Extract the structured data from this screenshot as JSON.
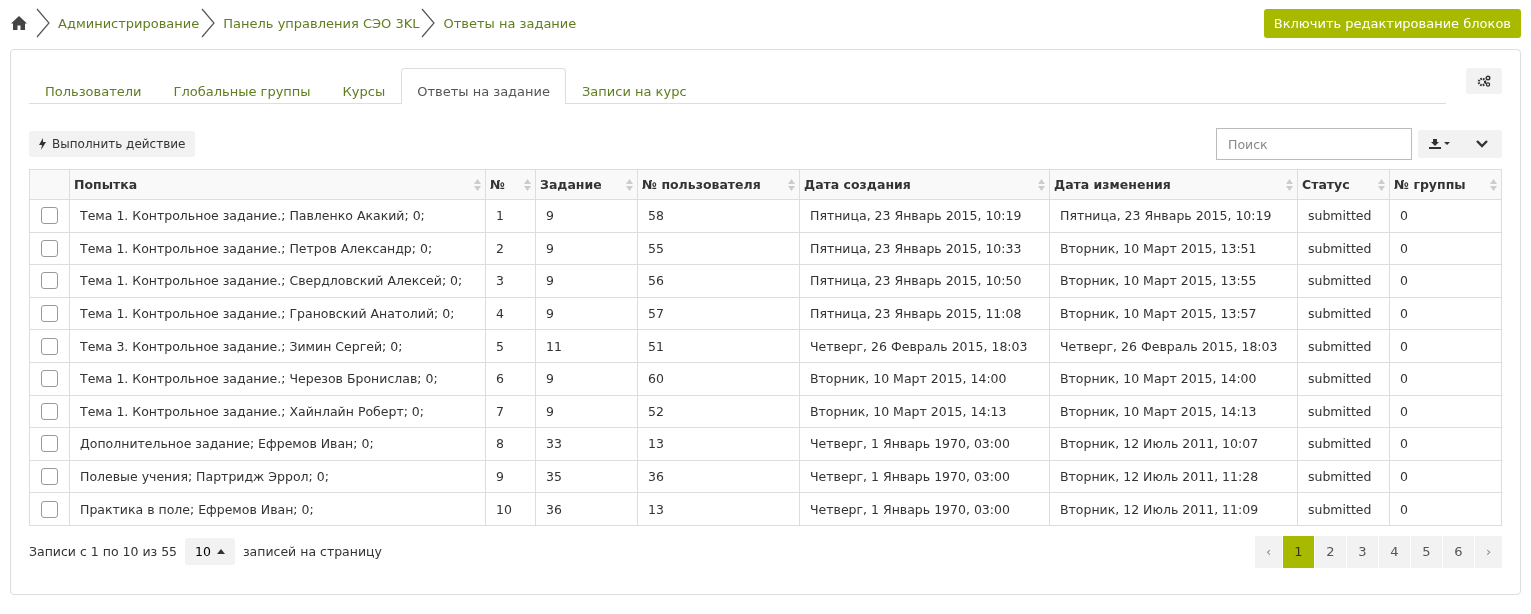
{
  "breadcrumb": [
    {
      "label": "Администрирование"
    },
    {
      "label": "Панель управления СЭО 3KL"
    },
    {
      "label": "Ответы на задание"
    }
  ],
  "edit_button": "Включить редактирование блоков",
  "tabs": [
    {
      "label": "Пользователи",
      "selected": false
    },
    {
      "label": "Глобальные группы",
      "selected": false
    },
    {
      "label": "Курсы",
      "selected": false
    },
    {
      "label": "Ответы на задание",
      "selected": true
    },
    {
      "label": "Записи на курс",
      "selected": false
    }
  ],
  "action_button": "Выполнить действие",
  "search": {
    "placeholder": "Поиск"
  },
  "table": {
    "columns": [
      "Попытка",
      "№",
      "Задание",
      "№ пользователя",
      "Дата создания",
      "Дата изменения",
      "Статус",
      "№ группы"
    ],
    "rows": [
      {
        "checked": false,
        "cells": [
          "Тема 1. Контрольное задание.; Павленко Акакий; 0;",
          "1",
          "9",
          "58",
          "Пятница, 23 Январь 2015, 10:19",
          "Пятница, 23 Январь 2015, 10:19",
          "submitted",
          "0"
        ]
      },
      {
        "checked": false,
        "cells": [
          "Тема 1. Контрольное задание.; Петров Александр; 0;",
          "2",
          "9",
          "55",
          "Пятница, 23 Январь 2015, 10:33",
          "Вторник, 10 Март 2015, 13:51",
          "submitted",
          "0"
        ]
      },
      {
        "checked": false,
        "cells": [
          "Тема 1. Контрольное задание.; Свердловский Алексей; 0;",
          "3",
          "9",
          "56",
          "Пятница, 23 Январь 2015, 10:50",
          "Вторник, 10 Март 2015, 13:55",
          "submitted",
          "0"
        ]
      },
      {
        "checked": false,
        "cells": [
          "Тема 1. Контрольное задание.; Грановский Анатолий; 0;",
          "4",
          "9",
          "57",
          "Пятница, 23 Январь 2015, 11:08",
          "Вторник, 10 Март 2015, 13:57",
          "submitted",
          "0"
        ]
      },
      {
        "checked": false,
        "cells": [
          "Тема 3. Контрольное задание.; Зимин Сергей; 0;",
          "5",
          "11",
          "51",
          "Четверг, 26 Февраль 2015, 18:03",
          "Четверг, 26 Февраль 2015, 18:03",
          "submitted",
          "0"
        ]
      },
      {
        "checked": false,
        "cells": [
          "Тема 1. Контрольное задание.; Черезов Бронислав; 0;",
          "6",
          "9",
          "60",
          "Вторник, 10 Март 2015, 14:00",
          "Вторник, 10 Март 2015, 14:00",
          "submitted",
          "0"
        ]
      },
      {
        "checked": false,
        "cells": [
          "Тема 1. Контрольное задание.; Хайнлайн Роберт; 0;",
          "7",
          "9",
          "52",
          "Вторник, 10 Март 2015, 14:13",
          "Вторник, 10 Март 2015, 14:13",
          "submitted",
          "0"
        ]
      },
      {
        "checked": false,
        "cells": [
          "Дополнительное задание; Ефремов Иван; 0;",
          "8",
          "33",
          "13",
          "Четверг, 1 Январь 1970, 03:00",
          "Вторник, 12 Июль 2011, 10:07",
          "submitted",
          "0"
        ]
      },
      {
        "checked": false,
        "cells": [
          "Полевые учения; Партридж Эррол; 0;",
          "9",
          "35",
          "36",
          "Четверг, 1 Январь 1970, 03:00",
          "Вторник, 12 Июль 2011, 11:28",
          "submitted",
          "0"
        ]
      },
      {
        "checked": false,
        "cells": [
          "Практика в поле; Ефремов Иван; 0;",
          "10",
          "36",
          "13",
          "Четверг, 1 Январь 1970, 03:00",
          "Вторник, 12 Июль 2011, 11:09",
          "submitted",
          "0"
        ]
      }
    ]
  },
  "footer": {
    "info": "Записи с 1 по 10 из 55",
    "page_size": "10",
    "page_size_label": "записей на страницу"
  },
  "pagination": {
    "prev": "‹",
    "pages": [
      {
        "label": "1",
        "selected": true
      },
      {
        "label": "2",
        "selected": false
      },
      {
        "label": "3",
        "selected": false
      },
      {
        "label": "4",
        "selected": false
      },
      {
        "label": "5",
        "selected": false
      },
      {
        "label": "6",
        "selected": false
      }
    ],
    "next": "›"
  }
}
